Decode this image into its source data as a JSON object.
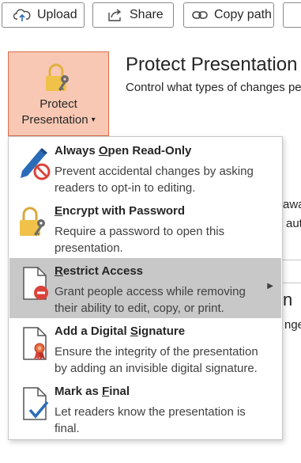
{
  "toolbar": {
    "upload_label": "Upload",
    "share_label": "Share",
    "copy_path_label": "Copy path"
  },
  "protect": {
    "button_line1": "Protect",
    "button_line2": "Presentation",
    "title": "Protect Presentation",
    "description": "Control what types of changes pe"
  },
  "background_fragments": {
    "frag1": "awa",
    "frag2": "aut",
    "frag3": "n",
    "frag4": "nge"
  },
  "menu": {
    "items": [
      {
        "title_pre": "Always ",
        "title_key": "O",
        "title_post": "pen Read-Only",
        "description": "Prevent accidental changes by asking readers to opt-in to editing.",
        "icon": "pencil-prohibited-icon"
      },
      {
        "title_pre": "",
        "title_key": "E",
        "title_post": "ncrypt with Password",
        "description": "Require a password to open this presentation.",
        "icon": "lock-key-icon"
      },
      {
        "title_pre": "",
        "title_key": "R",
        "title_post": "estrict Access",
        "description": "Grant people access while removing their ability to edit, copy, or print.",
        "icon": "document-restricted-icon"
      },
      {
        "title_pre": "Add a Digital ",
        "title_key": "S",
        "title_post": "ignature",
        "description": "Ensure the integrity of the presentation by adding an invisible digital signature.",
        "icon": "document-ribbon-icon"
      },
      {
        "title_pre": "Mark as ",
        "title_key": "F",
        "title_post": "inal",
        "description": "Let readers know the presentation is final.",
        "icon": "document-check-icon"
      }
    ]
  },
  "colors": {
    "accent_bg": "#f8c8b4",
    "accent_border": "#d86e4a",
    "hover_bg": "#c8c8c8",
    "icon_blue": "#2b6cb8",
    "icon_red": "#d9433b"
  }
}
